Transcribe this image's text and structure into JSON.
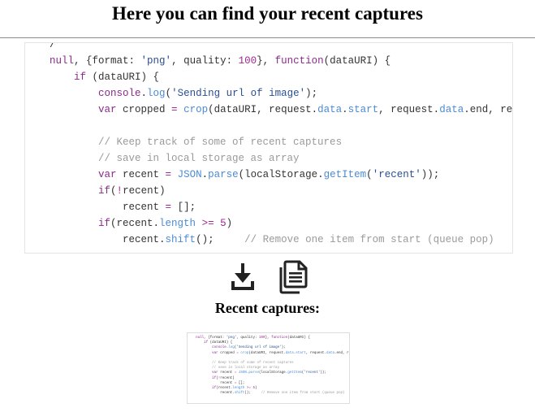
{
  "header": {
    "title": "Here you can find your recent captures"
  },
  "code": {
    "lines": [
      [
        {
          "t": "    ",
          "c": "plain"
        },
        {
          "t": "/",
          "c": "plain"
        }
      ],
      [
        {
          "t": "    ",
          "c": "plain"
        },
        {
          "t": "null",
          "c": "kw"
        },
        {
          "t": ", {format: ",
          "c": "plain"
        },
        {
          "t": "'png'",
          "c": "str"
        },
        {
          "t": ", quality: ",
          "c": "plain"
        },
        {
          "t": "100",
          "c": "num"
        },
        {
          "t": "}, ",
          "c": "plain"
        },
        {
          "t": "function",
          "c": "kw"
        },
        {
          "t": "(dataURI) {",
          "c": "plain"
        }
      ],
      [
        {
          "t": "        ",
          "c": "plain"
        },
        {
          "t": "if",
          "c": "kw"
        },
        {
          "t": " (dataURI) {",
          "c": "plain"
        }
      ],
      [
        {
          "t": "            ",
          "c": "plain"
        },
        {
          "t": "console",
          "c": "kw"
        },
        {
          "t": ".",
          "c": "plain"
        },
        {
          "t": "log",
          "c": "call"
        },
        {
          "t": "(",
          "c": "plain"
        },
        {
          "t": "'Sending url of image'",
          "c": "str"
        },
        {
          "t": ");",
          "c": "plain"
        }
      ],
      [
        {
          "t": "            ",
          "c": "plain"
        },
        {
          "t": "var",
          "c": "kw"
        },
        {
          "t": " cropped ",
          "c": "plain"
        },
        {
          "t": "=",
          "c": "op"
        },
        {
          "t": " ",
          "c": "plain"
        },
        {
          "t": "crop",
          "c": "call"
        },
        {
          "t": "(dataURI, request.",
          "c": "plain"
        },
        {
          "t": "data",
          "c": "prop"
        },
        {
          "t": ".",
          "c": "plain"
        },
        {
          "t": "start",
          "c": "prop"
        },
        {
          "t": ", request.",
          "c": "plain"
        },
        {
          "t": "data",
          "c": "prop"
        },
        {
          "t": ".end, reques",
          "c": "plain"
        }
      ],
      [
        {
          "t": "",
          "c": "plain"
        }
      ],
      [
        {
          "t": "            ",
          "c": "plain"
        },
        {
          "t": "// Keep track of some of recent captures",
          "c": "com"
        }
      ],
      [
        {
          "t": "            ",
          "c": "plain"
        },
        {
          "t": "// save in local storage as array",
          "c": "com"
        }
      ],
      [
        {
          "t": "            ",
          "c": "plain"
        },
        {
          "t": "var",
          "c": "kw"
        },
        {
          "t": " recent ",
          "c": "plain"
        },
        {
          "t": "=",
          "c": "op"
        },
        {
          "t": " ",
          "c": "plain"
        },
        {
          "t": "JSON",
          "c": "call"
        },
        {
          "t": ".",
          "c": "plain"
        },
        {
          "t": "parse",
          "c": "call"
        },
        {
          "t": "(localStorage.",
          "c": "plain"
        },
        {
          "t": "getItem",
          "c": "call"
        },
        {
          "t": "(",
          "c": "plain"
        },
        {
          "t": "'recent'",
          "c": "str"
        },
        {
          "t": "));",
          "c": "plain"
        }
      ],
      [
        {
          "t": "            ",
          "c": "plain"
        },
        {
          "t": "if",
          "c": "kw"
        },
        {
          "t": "(",
          "c": "plain"
        },
        {
          "t": "!",
          "c": "op"
        },
        {
          "t": "recent)",
          "c": "plain"
        }
      ],
      [
        {
          "t": "                ",
          "c": "plain"
        },
        {
          "t": "recent ",
          "c": "plain"
        },
        {
          "t": "=",
          "c": "op"
        },
        {
          "t": " [];",
          "c": "plain"
        }
      ],
      [
        {
          "t": "            ",
          "c": "plain"
        },
        {
          "t": "if",
          "c": "kw"
        },
        {
          "t": "(recent.",
          "c": "plain"
        },
        {
          "t": "length",
          "c": "prop"
        },
        {
          "t": " ",
          "c": "plain"
        },
        {
          "t": ">=",
          "c": "op"
        },
        {
          "t": " ",
          "c": "plain"
        },
        {
          "t": "5",
          "c": "num"
        },
        {
          "t": ")",
          "c": "plain"
        }
      ],
      [
        {
          "t": "                ",
          "c": "plain"
        },
        {
          "t": "recent.",
          "c": "plain"
        },
        {
          "t": "shift",
          "c": "call"
        },
        {
          "t": "();     ",
          "c": "plain"
        },
        {
          "t": "// Remove one item from start (queue pop)",
          "c": "com"
        }
      ]
    ]
  },
  "toolbar": {
    "download_icon": "download-icon",
    "copy_icon": "copy-icon"
  },
  "captures": {
    "title": "Recent captures:",
    "thumbnail_lines": [
      [
        {
          "t": "    ",
          "c": "plain"
        },
        {
          "t": "null",
          "c": "kw"
        },
        {
          "t": ", {format: ",
          "c": "plain"
        },
        {
          "t": "'png'",
          "c": "str"
        },
        {
          "t": ", quality: ",
          "c": "plain"
        },
        {
          "t": "100",
          "c": "num"
        },
        {
          "t": "}, ",
          "c": "plain"
        },
        {
          "t": "function",
          "c": "kw"
        },
        {
          "t": "(dataURI) {",
          "c": "plain"
        }
      ],
      [
        {
          "t": "        ",
          "c": "plain"
        },
        {
          "t": "if",
          "c": "kw"
        },
        {
          "t": " (dataURI) {",
          "c": "plain"
        }
      ],
      [
        {
          "t": "            ",
          "c": "plain"
        },
        {
          "t": "console",
          "c": "kw"
        },
        {
          "t": ".",
          "c": "plain"
        },
        {
          "t": "log",
          "c": "call"
        },
        {
          "t": "(",
          "c": "plain"
        },
        {
          "t": "'Sending url of image'",
          "c": "str"
        },
        {
          "t": ");",
          "c": "plain"
        }
      ],
      [
        {
          "t": "            ",
          "c": "plain"
        },
        {
          "t": "var",
          "c": "kw"
        },
        {
          "t": " cropped ",
          "c": "plain"
        },
        {
          "t": "=",
          "c": "op"
        },
        {
          "t": " ",
          "c": "plain"
        },
        {
          "t": "crop",
          "c": "call"
        },
        {
          "t": "(dataURI, request.",
          "c": "plain"
        },
        {
          "t": "data",
          "c": "prop"
        },
        {
          "t": ".",
          "c": "plain"
        },
        {
          "t": "start",
          "c": "prop"
        },
        {
          "t": ", request.",
          "c": "plain"
        },
        {
          "t": "data",
          "c": "prop"
        },
        {
          "t": ".end, reque",
          "c": "plain"
        }
      ],
      [
        {
          "t": "",
          "c": "plain"
        }
      ],
      [
        {
          "t": "            ",
          "c": "plain"
        },
        {
          "t": "// Keep track of some of recent captures",
          "c": "com"
        }
      ],
      [
        {
          "t": "            ",
          "c": "plain"
        },
        {
          "t": "// save in local storage as array",
          "c": "com"
        }
      ],
      [
        {
          "t": "            ",
          "c": "plain"
        },
        {
          "t": "var",
          "c": "kw"
        },
        {
          "t": " recent ",
          "c": "plain"
        },
        {
          "t": "=",
          "c": "op"
        },
        {
          "t": " ",
          "c": "plain"
        },
        {
          "t": "JSON",
          "c": "call"
        },
        {
          "t": ".",
          "c": "plain"
        },
        {
          "t": "parse",
          "c": "call"
        },
        {
          "t": "(localStorage.",
          "c": "plain"
        },
        {
          "t": "getItem",
          "c": "call"
        },
        {
          "t": "(",
          "c": "plain"
        },
        {
          "t": "'recent'",
          "c": "str"
        },
        {
          "t": "));",
          "c": "plain"
        }
      ],
      [
        {
          "t": "            ",
          "c": "plain"
        },
        {
          "t": "if",
          "c": "kw"
        },
        {
          "t": "(",
          "c": "plain"
        },
        {
          "t": "!",
          "c": "op"
        },
        {
          "t": "recent)",
          "c": "plain"
        }
      ],
      [
        {
          "t": "                ",
          "c": "plain"
        },
        {
          "t": "recent ",
          "c": "plain"
        },
        {
          "t": "=",
          "c": "op"
        },
        {
          "t": " [];",
          "c": "plain"
        }
      ],
      [
        {
          "t": "            ",
          "c": "plain"
        },
        {
          "t": "if",
          "c": "kw"
        },
        {
          "t": "(recent.",
          "c": "plain"
        },
        {
          "t": "length",
          "c": "prop"
        },
        {
          "t": " ",
          "c": "plain"
        },
        {
          "t": ">=",
          "c": "op"
        },
        {
          "t": " ",
          "c": "plain"
        },
        {
          "t": "5",
          "c": "num"
        },
        {
          "t": ")",
          "c": "plain"
        }
      ],
      [
        {
          "t": "                ",
          "c": "plain"
        },
        {
          "t": "recent.",
          "c": "plain"
        },
        {
          "t": "shift",
          "c": "call"
        },
        {
          "t": "();     ",
          "c": "plain"
        },
        {
          "t": "// Remove one item from start (queue pop)",
          "c": "com"
        }
      ]
    ]
  },
  "colors": {
    "keyword": "#8b2a8b",
    "string": "#2a4e91",
    "number": "#a0278f",
    "call": "#4b8bd6",
    "comment": "#9a9a9a",
    "text": "#333333"
  }
}
